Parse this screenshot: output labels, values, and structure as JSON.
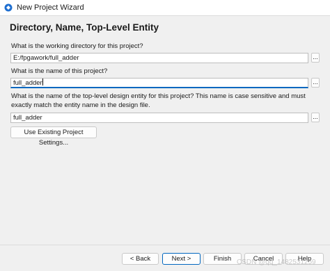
{
  "window": {
    "title": "New Project Wizard",
    "icon": "quartus-app-icon"
  },
  "heading": "Directory, Name, Top-Level Entity",
  "directory": {
    "question": "What is the working directory for this project?",
    "value": "E:/fpgawork/full_adder",
    "browse_label": "..."
  },
  "project_name": {
    "question": "What is the name of this project?",
    "value": "full_adder",
    "browse_label": "..."
  },
  "top_entity": {
    "question": "What is the name of the top-level design entity for this project? This name is case sensitive and must exactly match the entity name in the design file.",
    "value": "full_adder",
    "browse_label": "..."
  },
  "use_existing_label": "Use Existing Project Settings...",
  "footer": {
    "back": "< Back",
    "next": "Next >",
    "finish": "Finish",
    "cancel": "Cancel",
    "help": "Help"
  },
  "watermark": "CSDN @qq_1482531259",
  "colors": {
    "accent": "#0067c0",
    "background": "#f0f0f0"
  }
}
